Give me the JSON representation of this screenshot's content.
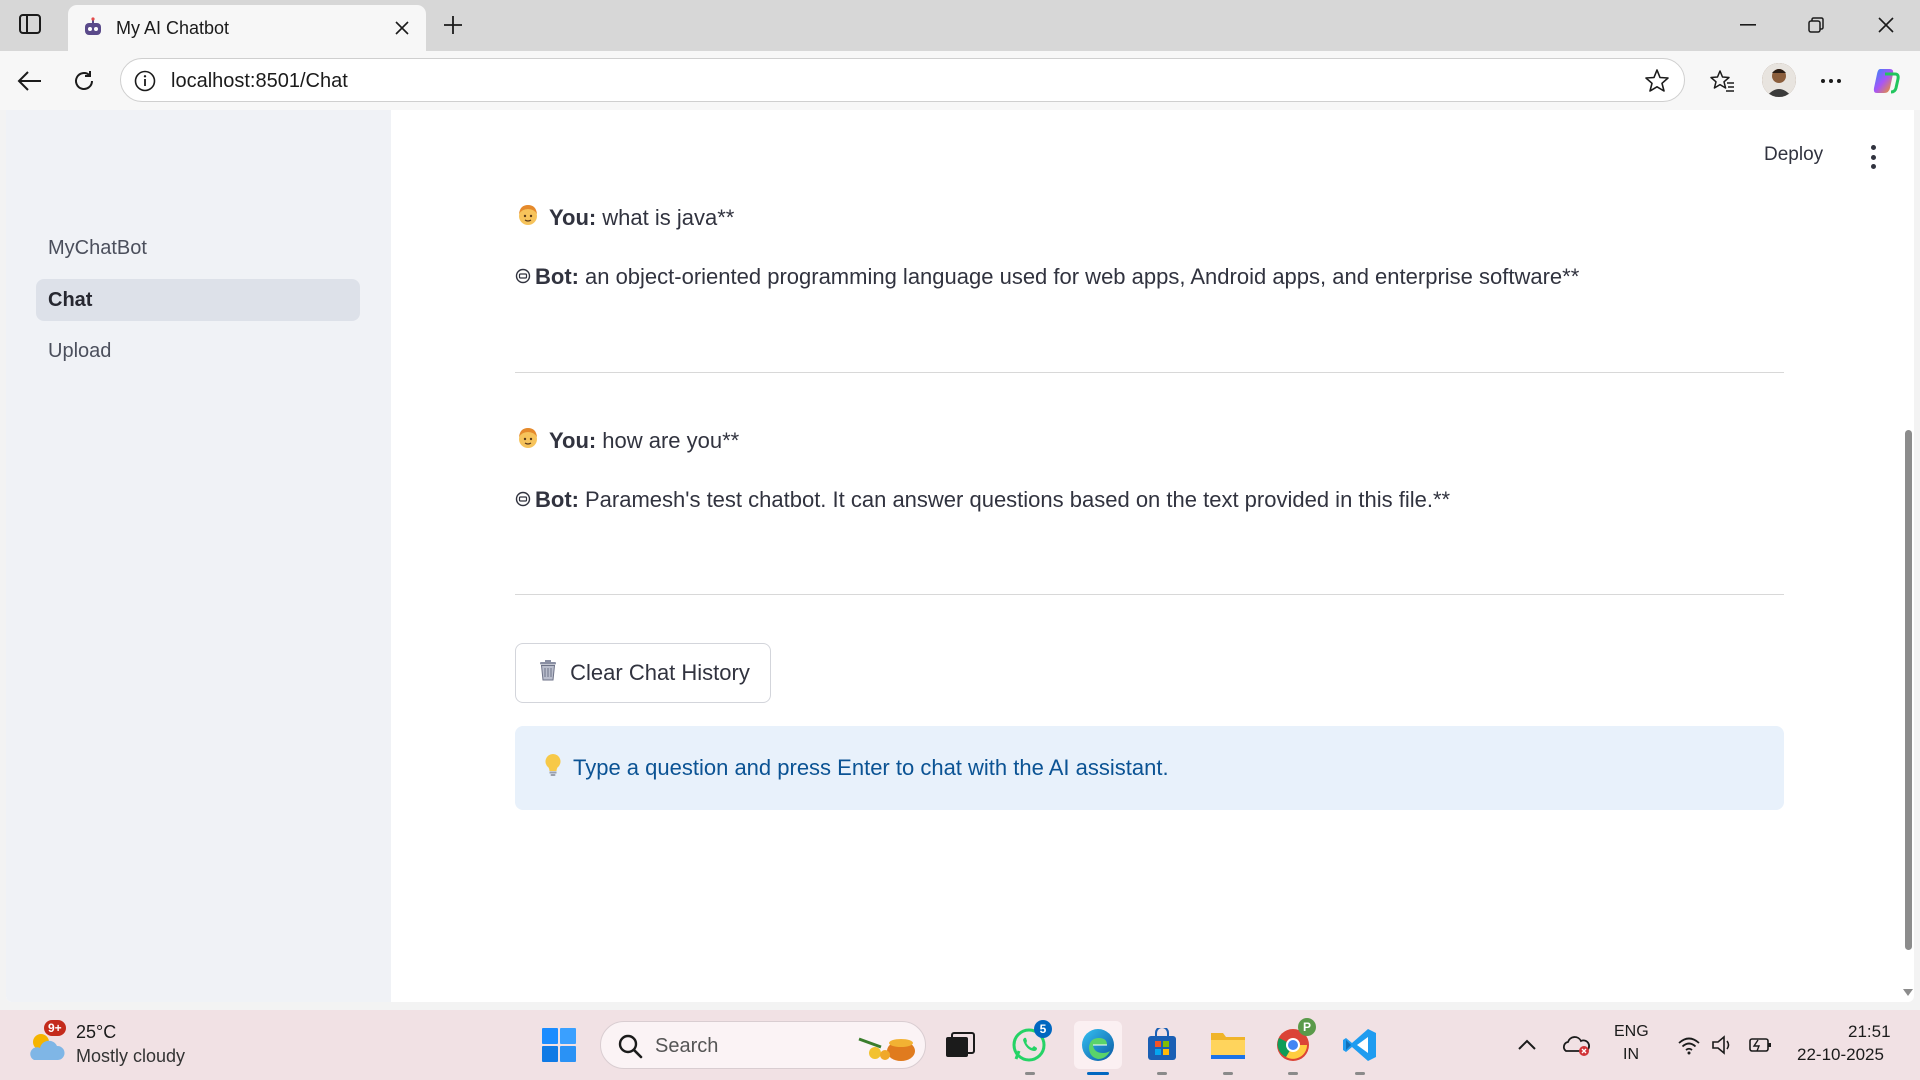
{
  "browser": {
    "tab_title": "My AI Chatbot",
    "url": "localhost:8501/Chat"
  },
  "sidebar": {
    "items": [
      {
        "label": "MyChatBot",
        "active": false
      },
      {
        "label": "Chat",
        "active": true
      },
      {
        "label": "Upload",
        "active": false
      }
    ]
  },
  "header": {
    "deploy_label": "Deploy"
  },
  "chat": {
    "messages": [
      {
        "you_label": "You:",
        "you_text": "what is java**",
        "bot_label": "Bot:",
        "bot_text": "an object-oriented programming language used for web apps, Android apps, and enterprise software**"
      },
      {
        "you_label": "You:",
        "you_text": "how are you**",
        "bot_label": "Bot:",
        "bot_text": "Paramesh's test chatbot. It can answer questions based on the text provided in this file.**"
      }
    ],
    "clear_button_label": "Clear Chat History",
    "info_text": "Type a question and press Enter to chat with the AI assistant."
  },
  "taskbar": {
    "weather_badge": "9+",
    "temperature": "25°C",
    "condition": "Mostly cloudy",
    "search_placeholder": "Search",
    "whatsapp_badge": "5",
    "chrome_profile_badge": "P",
    "language_line1": "ENG",
    "language_line2": "IN",
    "time": "21:51",
    "date": "22-10-2025"
  },
  "colors": {
    "sidebar_bg": "#f0f2f6",
    "active_nav_bg": "#dde1e9",
    "info_bg": "#e8f1fb",
    "info_text": "#0b5394",
    "taskbar_bg": "#f1e1e4",
    "accent": "#0067c0"
  },
  "icons": [
    "sidebar-toggle-icon",
    "robot-favicon-icon",
    "close-icon",
    "plus-icon",
    "minimize-icon",
    "restore-icon",
    "back-arrow-icon",
    "refresh-icon",
    "info-icon",
    "star-icon",
    "favorites-icon",
    "more-icon",
    "copilot-icon",
    "user-emoji-icon",
    "bot-emoji-icon",
    "trash-icon",
    "lightbulb-icon",
    "weather-icon",
    "windows-start-icon",
    "search-icon",
    "wifi-icon",
    "volume-icon",
    "battery-icon"
  ]
}
